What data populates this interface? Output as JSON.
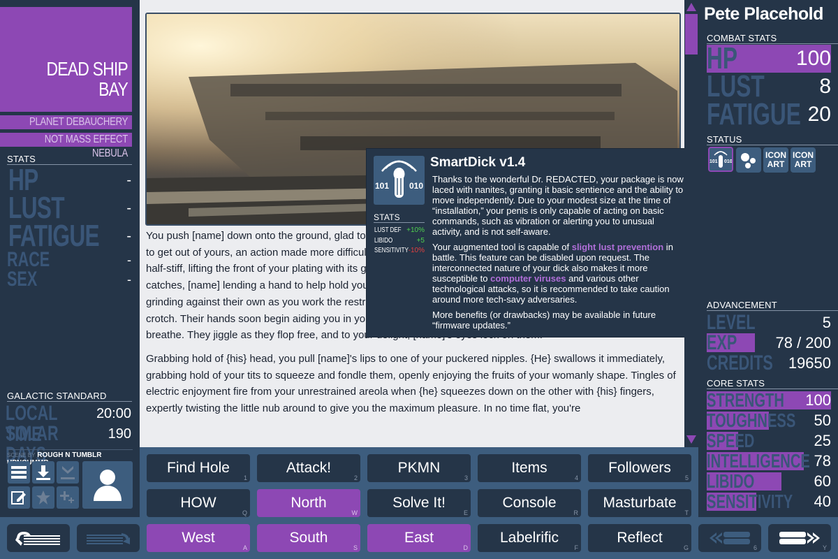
{
  "location": {
    "title_line1": "DEAD SHIP",
    "title_line2": "BAY",
    "planet": "PLANET DEBAUCHERY",
    "region": "NOT MASS EFFECT NEBULA"
  },
  "left_stats": {
    "header": "STATS",
    "items": [
      {
        "label": "HP",
        "value": "-"
      },
      {
        "label": "LUST",
        "value": "-"
      },
      {
        "label": "FATIGUE",
        "value": "-"
      },
      {
        "label": "RACE",
        "value": "-"
      },
      {
        "label": "SEX",
        "value": "-"
      }
    ]
  },
  "time": {
    "header": "GALACTIC STANDARD",
    "local_time_label": "LOCAL TIME",
    "local_time": "20:00",
    "solar_days_label": "SOLAR DAYS",
    "solar_days": "190"
  },
  "scene_credit": {
    "prefix": "SCENE BY",
    "author": "ROUGH N TUMBLR UPNCUMMR"
  },
  "story": {
    "p1": "You push [name] down onto the ground, glad to be rid of the burdensome weight of their armor. But you've still got to get out of yours, an action made more difficult by the rising heat in your groin. Your rebellious cock is already half-stiff, lifting the front of your plating with its growth. After some scrabbling, you struggle with your chestpiece's catches, [name] lending a hand to help hold you steady while you fight to remove it.  You straddle [name], hips grinding against their own as you work the restraining material free, practically grinding your bulge against their crotch. Their hands soon begin aiding you in your task, allowing your tightly compressed breasts to finally, happily breathe.  They jiggle as they flop free, and to your delight, [name]'s eyes lock on them.",
    "p2": "Grabbing hold of {his} head, you pull [name]'s lips to one of your puckered nipples.  {He} swallows it immediately, grabbing hold of your tits to squeeze and fondle them, openly enjoying the fruits of your womanly shape. Tingles of electric enjoyment fire from your unrestrained areola when {he} squeezes down on the other with {his} fingers, expertly twisting the little nub around to give you the maximum pleasure.  In no time flat, you're"
  },
  "tooltip": {
    "title": "SmartDick v1.4",
    "icon_name": "smartdick-icon",
    "icon_left": "101",
    "icon_right": "010",
    "stats_header": "STATS",
    "stats": [
      {
        "name": "LUST DEF",
        "value": "+10%",
        "color": "#4fd14f"
      },
      {
        "name": "LIBIDO",
        "value": "+5",
        "color": "#4fd14f"
      },
      {
        "name": "SENSITIVITY",
        "value": "-10%",
        "color": "#e04040"
      }
    ],
    "d1": "Thanks to the wonderful Dr. REDACTED, your package is now laced with nanites, granting it basic sentience and the ability to move independently. Due to your modest size at the time of “installation,” your penis is only capable of acting on basic commands, such as vibration or alerting you to unusual activity, and is not self-aware.",
    "d2a": "Your augmented tool is capable of ",
    "d2_hl1": "slight lust prevention",
    "d2b": " in battle. This feature can be disabled upon request. The interconnected nature of your dick also makes it more susceptible to ",
    "d2_hl2": "computer viruses",
    "d2c": " and various other technological attacks, so it is recommended to take caution around more tech-savy adversaries.",
    "d3": "More benefits (or drawbacks) may be available in future “firmware updates.”"
  },
  "player": {
    "name": "Pete Placehold"
  },
  "combat": {
    "header": "COMBAT STATS",
    "items": [
      {
        "label": "HP",
        "value": "100",
        "fill": 1.0
      },
      {
        "label": "LUST",
        "value": "8",
        "fill": 0.0
      },
      {
        "label": "FATIGUE",
        "value": "20",
        "fill": 0.0
      }
    ]
  },
  "status": {
    "header": "STATUS",
    "icons": [
      {
        "name": "smartdick-status-icon",
        "l1": "101",
        "l2": "010"
      },
      {
        "name": "bubbles-status-icon"
      },
      {
        "name": "icon-art-status-icon",
        "l1": "ICON",
        "l2": "ART"
      },
      {
        "name": "icon-art-status-icon",
        "l1": "ICON",
        "l2": "ART"
      }
    ]
  },
  "advancement": {
    "header": "ADVANCEMENT",
    "items": [
      {
        "label": "LEVEL",
        "value": "5",
        "fill": 0
      },
      {
        "label": "EXP",
        "value": "78 / 200",
        "fill": 0.39
      },
      {
        "label": "CREDITS",
        "value": "19650",
        "fill": 0
      }
    ]
  },
  "core": {
    "header": "CORE STATS",
    "items": [
      {
        "label": "STRENGTH",
        "value": "100",
        "fill": 1.0
      },
      {
        "label": "TOUGHNESS",
        "value": "50",
        "fill": 0.5
      },
      {
        "label": "SPEED",
        "value": "25",
        "fill": 0.25
      },
      {
        "label": "INTELLIGENCE",
        "value": "78",
        "fill": 0.78
      },
      {
        "label": "LIBIDO",
        "value": "60",
        "fill": 0.6
      },
      {
        "label": "SENSITIVITY",
        "value": "40",
        "fill": 0.4
      }
    ]
  },
  "buttons": [
    {
      "label": "Find Hole",
      "key": "1",
      "purple": false
    },
    {
      "label": "Attack!",
      "key": "2",
      "purple": false
    },
    {
      "label": "PKMN",
      "key": "3",
      "purple": false
    },
    {
      "label": "Items",
      "key": "4",
      "purple": false
    },
    {
      "label": "Followers",
      "key": "5",
      "purple": false
    },
    {
      "label": "HOW",
      "key": "Q",
      "purple": false
    },
    {
      "label": "North",
      "key": "W",
      "purple": true
    },
    {
      "label": "Solve It!",
      "key": "E",
      "purple": false
    },
    {
      "label": "Console",
      "key": "R",
      "purple": false
    },
    {
      "label": "Masturbate",
      "key": "T",
      "purple": false
    },
    {
      "label": "West",
      "key": "A",
      "purple": true
    },
    {
      "label": "South",
      "key": "S",
      "purple": true
    },
    {
      "label": "East",
      "key": "D",
      "purple": true
    },
    {
      "label": "Labelrific",
      "key": "F",
      "purple": false
    },
    {
      "label": "Reflect",
      "key": "G",
      "purple": false
    }
  ],
  "page_nav": {
    "prev_key": "6",
    "next_key": "Y"
  }
}
